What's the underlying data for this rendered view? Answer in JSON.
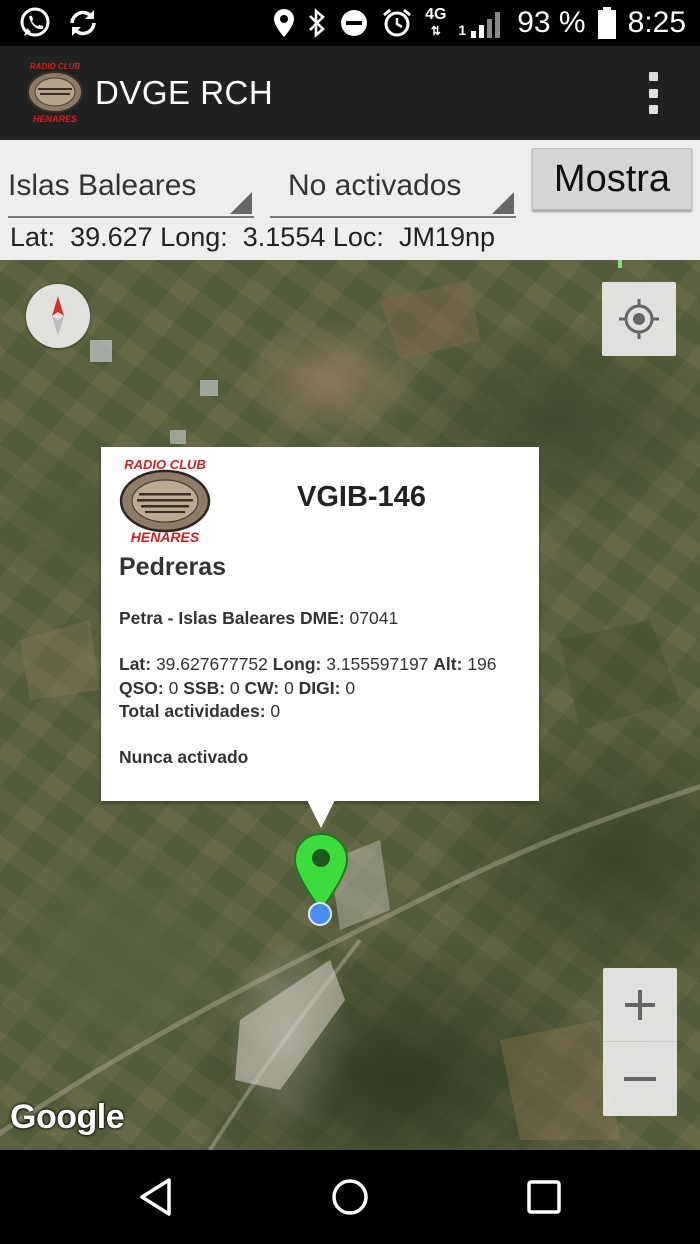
{
  "status_bar": {
    "network": "4G",
    "sim": "1",
    "battery": "93 %",
    "time": "8:25",
    "icons": [
      "whatsapp-icon",
      "sync-icon",
      "location-icon",
      "bluetooth-icon",
      "dnd-icon",
      "alarm-icon",
      "signal-icon",
      "battery-icon"
    ]
  },
  "app_bar": {
    "title": "DVGE RCH",
    "logo_icon": "radio-club-henares-logo",
    "menu_icon": "overflow-menu-icon"
  },
  "filters": {
    "region": "Islas Baleares",
    "status": "No activados",
    "button": "Mostra"
  },
  "coords": {
    "lat_label": "Lat:",
    "lat": "39.627",
    "long_label": "Long:",
    "long": "3.1554",
    "loc_label": "Loc:",
    "loc": "JM19np"
  },
  "map": {
    "attribution": "Google",
    "controls": [
      "compass-icon",
      "my-location-icon",
      "zoom-in-icon",
      "zoom-out-icon"
    ]
  },
  "info_window": {
    "code": "VGIB-146",
    "name": "Pedreras",
    "place": "Petra - Islas Baleares DME:",
    "dme": "07041",
    "lat_label": "Lat:",
    "lat": "39.627677752",
    "long_label": "Long:",
    "long": "3.155597197",
    "alt_label": "Alt:",
    "alt": "196",
    "qso_label": "QSO:",
    "qso": "0",
    "ssb_label": "SSB:",
    "ssb": "0",
    "cw_label": "CW:",
    "cw": "0",
    "digi_label": "DIGI:",
    "digi": "0",
    "total_label": "Total actividades:",
    "total": "0",
    "status": "Nunca activado"
  },
  "colors": {
    "marker": "#3ddc3d",
    "app_bar": "#212121",
    "filter_bar": "#eeeeee",
    "my_location": "#4a8cf0"
  }
}
